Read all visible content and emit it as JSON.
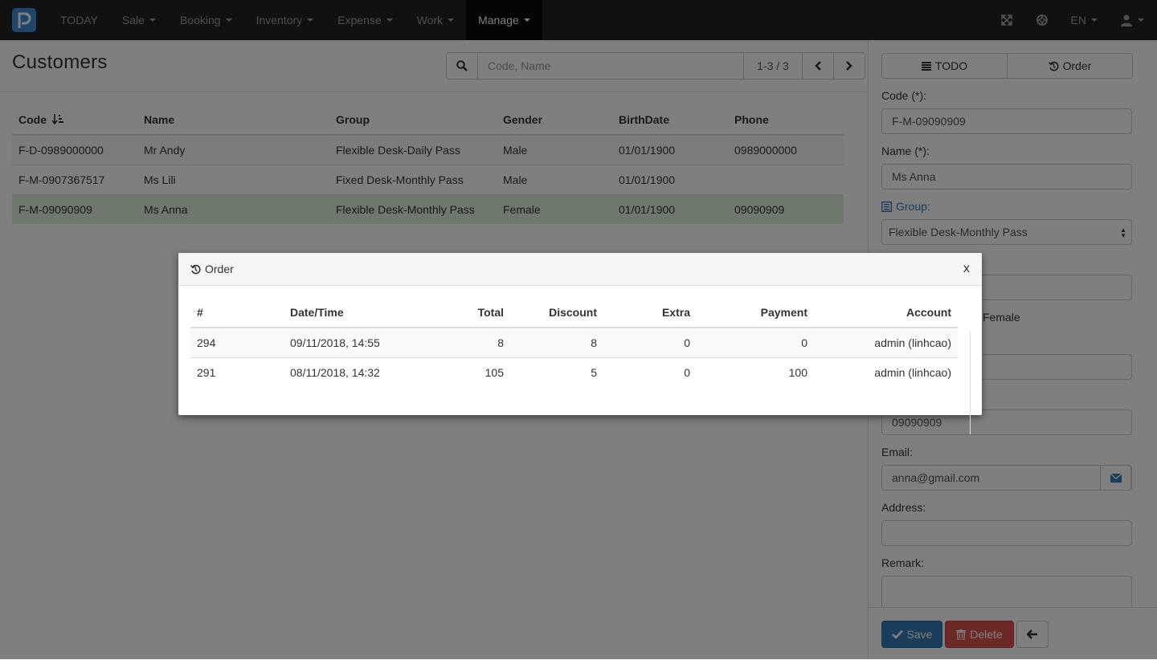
{
  "navbar": {
    "brand_icon": "p-logo-icon",
    "items": [
      {
        "label": "TODAY",
        "dropdown": false,
        "active": false
      },
      {
        "label": "Sale",
        "dropdown": true,
        "active": false
      },
      {
        "label": "Booking",
        "dropdown": true,
        "active": false
      },
      {
        "label": "Inventory",
        "dropdown": true,
        "active": false
      },
      {
        "label": "Expense",
        "dropdown": true,
        "active": false
      },
      {
        "label": "Work",
        "dropdown": true,
        "active": false
      },
      {
        "label": "Manage",
        "dropdown": true,
        "active": true
      }
    ],
    "language": "EN"
  },
  "page": {
    "title": "Customers",
    "search_placeholder": "Code, Name",
    "pager_count": "1-3 / 3"
  },
  "customers_table": {
    "headers": {
      "code": "Code",
      "name": "Name",
      "group": "Group",
      "gender": "Gender",
      "birthdate": "BirthDate",
      "phone": "Phone"
    },
    "rows": [
      {
        "code": "F-D-0989000000",
        "name": "Mr Andy",
        "group": "Flexible Desk-Daily Pass",
        "gender": "Male",
        "birthdate": "01/01/1900",
        "phone": "0989000000"
      },
      {
        "code": "F-M-0907367517",
        "name": "Ms Lili",
        "group": "Fixed Desk-Monthly Pass",
        "gender": "Male",
        "birthdate": "01/01/1900",
        "phone": ""
      },
      {
        "code": "F-M-09090909",
        "name": "Ms Anna",
        "group": "Flexible Desk-Monthly Pass",
        "gender": "Female",
        "birthdate": "01/01/1900",
        "phone": "09090909"
      }
    ]
  },
  "side": {
    "tab_todo": "TODO",
    "tab_order": "Order",
    "code_label": "Code (*):",
    "code_value": "F-M-09090909",
    "name_label": "Name (*):",
    "name_value": "Ms Anna",
    "group_label": "Group:",
    "group_value": "Flexible Desk-Monthly Pass",
    "gender_value": "Female",
    "phone_value": "09090909",
    "email_label": "Email:",
    "email_value": "anna@gmail.com",
    "address_label": "Address:",
    "remark_label": "Remark:",
    "save_label": "Save",
    "delete_label": "Delete"
  },
  "modal": {
    "title": "Order",
    "close_label": "x",
    "headers": {
      "id": "#",
      "datetime": "Date/Time",
      "total": "Total",
      "discount": "Discount",
      "extra": "Extra",
      "payment": "Payment",
      "account": "Account"
    },
    "rows": [
      {
        "id": "294",
        "datetime": "09/11/2018, 14:55",
        "total": "8",
        "discount": "8",
        "extra": "0",
        "payment": "0",
        "account": "admin (linhcao)"
      },
      {
        "id": "291",
        "datetime": "08/11/2018, 14:32",
        "total": "105",
        "discount": "5",
        "extra": "0",
        "payment": "100",
        "account": "admin (linhcao)"
      }
    ]
  },
  "colors": {
    "navbar": "#222222",
    "brand": "#3d8fd6",
    "primary": "#337ab7",
    "danger": "#d9534f",
    "selected_row": "#dff0d8"
  }
}
